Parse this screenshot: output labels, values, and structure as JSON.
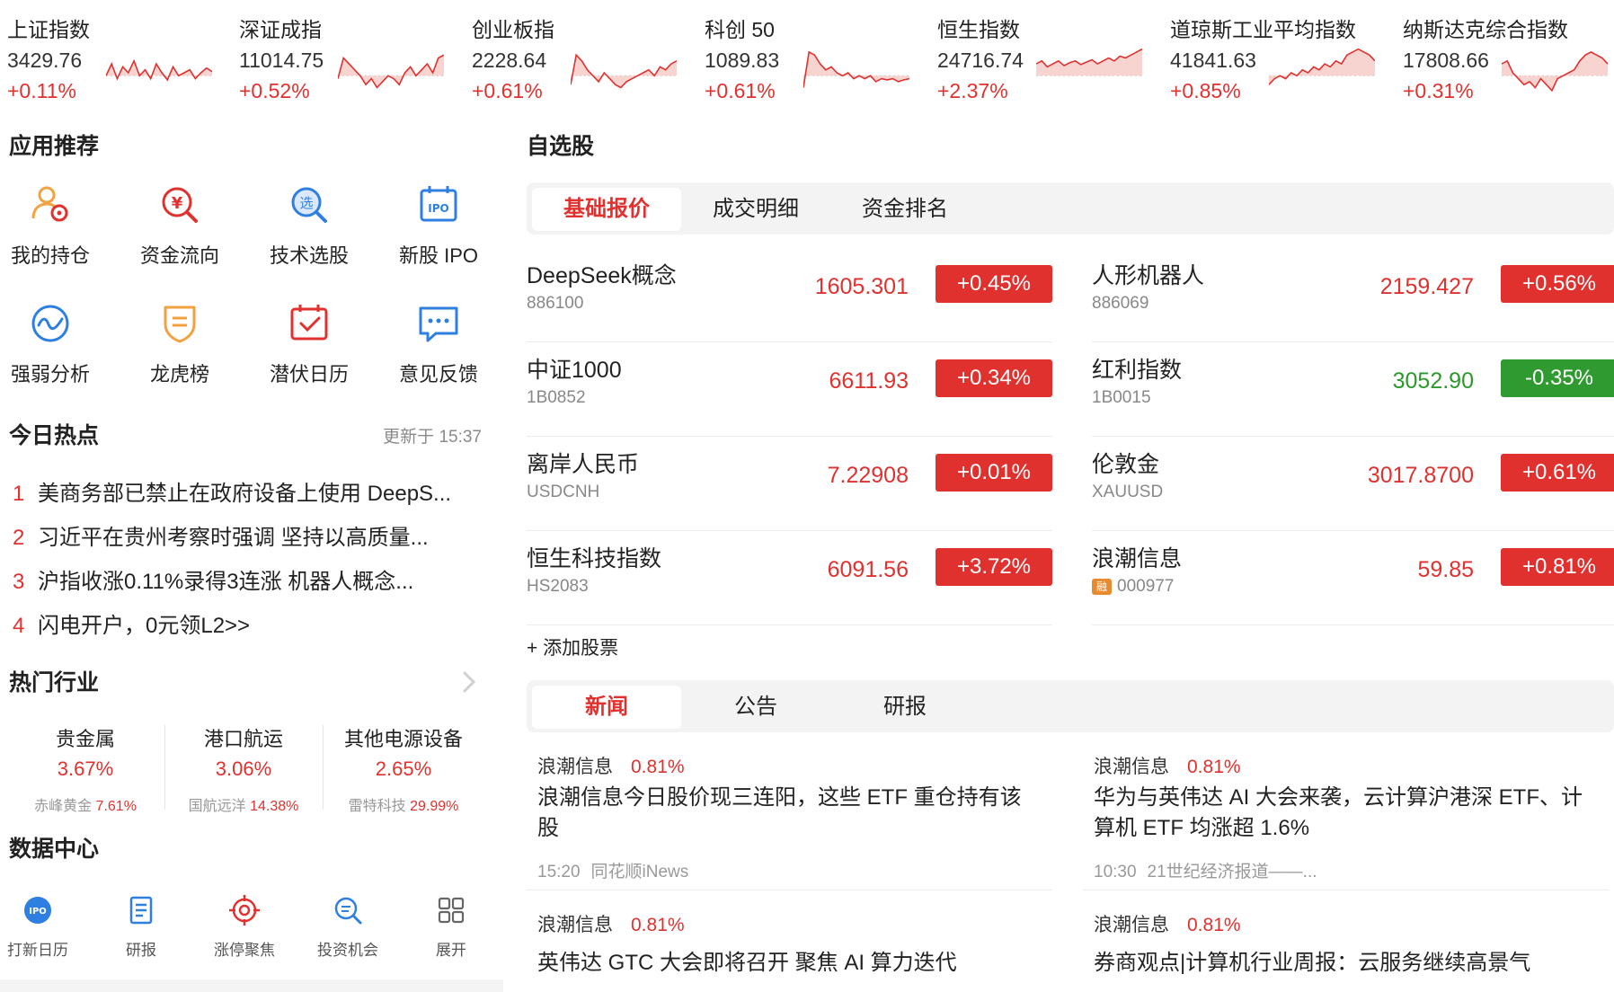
{
  "indices": [
    {
      "name": "上证指数",
      "value": "3429.76",
      "change": "+0.11%",
      "trend": "up",
      "spark": [
        0.55,
        0.35,
        0.6,
        0.4,
        0.5,
        0.3,
        0.55,
        0.45,
        0.6,
        0.35,
        0.5,
        0.62,
        0.4,
        0.55,
        0.5,
        0.45,
        0.6,
        0.5,
        0.42,
        0.48
      ]
    },
    {
      "name": "深证成指",
      "value": "11014.75",
      "change": "+0.52%",
      "trend": "up",
      "spark": [
        0.6,
        0.25,
        0.35,
        0.45,
        0.55,
        0.7,
        0.6,
        0.75,
        0.65,
        0.55,
        0.6,
        0.7,
        0.5,
        0.4,
        0.55,
        0.45,
        0.35,
        0.5,
        0.25,
        0.2
      ]
    },
    {
      "name": "创业板指",
      "value": "2228.64",
      "change": "+0.61%",
      "trend": "up",
      "spark": [
        0.7,
        0.2,
        0.3,
        0.45,
        0.55,
        0.65,
        0.5,
        0.6,
        0.7,
        0.75,
        0.65,
        0.6,
        0.55,
        0.5,
        0.45,
        0.55,
        0.4,
        0.45,
        0.35,
        0.3
      ]
    },
    {
      "name": "科创 50",
      "value": "1089.83",
      "change": "+0.61%",
      "trend": "up",
      "spark": [
        0.75,
        0.15,
        0.2,
        0.35,
        0.45,
        0.4,
        0.5,
        0.55,
        0.5,
        0.6,
        0.55,
        0.6,
        0.55,
        0.65,
        0.6,
        0.62,
        0.6,
        0.65,
        0.62,
        0.6
      ]
    },
    {
      "name": "恒生指数",
      "value": "24716.74",
      "change": "+2.37%",
      "trend": "up",
      "spark": [
        0.35,
        0.3,
        0.4,
        0.35,
        0.3,
        0.38,
        0.33,
        0.3,
        0.36,
        0.32,
        0.28,
        0.35,
        0.3,
        0.25,
        0.3,
        0.22,
        0.25,
        0.2,
        0.15,
        0.1
      ]
    },
    {
      "name": "道琼斯工业平均指数",
      "value": "41841.63",
      "change": "+0.85%",
      "trend": "up",
      "spark": [
        0.7,
        0.6,
        0.55,
        0.6,
        0.5,
        0.55,
        0.45,
        0.5,
        0.4,
        0.45,
        0.35,
        0.4,
        0.3,
        0.35,
        0.2,
        0.15,
        0.1,
        0.15,
        0.2,
        0.3
      ]
    },
    {
      "name": "纳斯达克综合指数",
      "value": "17808.66",
      "change": "+0.31%",
      "trend": "up",
      "spark": [
        0.35,
        0.3,
        0.5,
        0.6,
        0.7,
        0.65,
        0.75,
        0.6,
        0.7,
        0.8,
        0.6,
        0.55,
        0.5,
        0.45,
        0.3,
        0.2,
        0.15,
        0.2,
        0.25,
        0.35
      ]
    }
  ],
  "apps": {
    "title": "应用推荐",
    "items": [
      {
        "label": "我的持仓",
        "icon": "person-holding-icon"
      },
      {
        "label": "资金流向",
        "icon": "money-flow-icon"
      },
      {
        "label": "技术选股",
        "icon": "stock-pick-icon"
      },
      {
        "label": "新股 IPO",
        "icon": "ipo-calendar-icon"
      },
      {
        "label": "强弱分析",
        "icon": "strength-analysis-icon"
      },
      {
        "label": "龙虎榜",
        "icon": "dragon-tiger-icon"
      },
      {
        "label": "潜伏日历",
        "icon": "latent-calendar-icon"
      },
      {
        "label": "意见反馈",
        "icon": "feedback-icon"
      }
    ],
    "icon_colors": {
      "orange": "#f2a240",
      "red": "#e0312f",
      "blue": "#2f7fe0"
    }
  },
  "hot": {
    "title": "今日热点",
    "updated": "更新于 15:37",
    "items": [
      {
        "rank": "1",
        "text": "美商务部已禁止在政府设备上使用 DeepS..."
      },
      {
        "rank": "2",
        "text": "习近平在贵州考察时强调 坚持以高质量..."
      },
      {
        "rank": "3",
        "text": "沪指收涨0.11%录得3连涨 机器人概念..."
      },
      {
        "rank": "4",
        "text": "闪电开户，0元领L2>>"
      }
    ]
  },
  "industries": {
    "title": "热门行业",
    "items": [
      {
        "name": "贵金属",
        "pct": "3.67%",
        "leader": "赤峰黄金",
        "leader_pct": "7.61%"
      },
      {
        "name": "港口航运",
        "pct": "3.06%",
        "leader": "国航远洋",
        "leader_pct": "14.38%"
      },
      {
        "name": "其他电源设备",
        "pct": "2.65%",
        "leader": "雷特科技",
        "leader_pct": "29.99%"
      }
    ]
  },
  "data_center": {
    "title": "数据中心",
    "items": [
      {
        "label": "打新日历",
        "icon": "ipo-badge-icon"
      },
      {
        "label": "研报",
        "icon": "report-icon"
      },
      {
        "label": "涨停聚焦",
        "icon": "target-icon"
      },
      {
        "label": "投资机会",
        "icon": "opportunity-icon"
      },
      {
        "label": "展开",
        "icon": "grid-expand-icon"
      }
    ]
  },
  "watchlist": {
    "title": "自选股",
    "tabs": [
      "基础报价",
      "成交明细",
      "资金排名"
    ],
    "active_tab": 0,
    "stocks": [
      {
        "name": "DeepSeek概念",
        "code": "886100",
        "price": "1605.301",
        "change": "+0.45%",
        "trend": "up"
      },
      {
        "name": "人形机器人",
        "code": "886069",
        "price": "2159.427",
        "change": "+0.56%",
        "trend": "up"
      },
      {
        "name": "中证1000",
        "code": "1B0852",
        "price": "6611.93",
        "change": "+0.34%",
        "trend": "up"
      },
      {
        "name": "红利指数",
        "code": "1B0015",
        "price": "3052.90",
        "change": "-0.35%",
        "trend": "down"
      },
      {
        "name": "离岸人民币",
        "code": "USDCNH",
        "price": "7.22908",
        "change": "+0.01%",
        "trend": "up"
      },
      {
        "name": "伦敦金",
        "code": "XAUUSD",
        "price": "3017.8700",
        "change": "+0.61%",
        "trend": "up"
      },
      {
        "name": "恒生科技指数",
        "code": "HS2083",
        "price": "6091.56",
        "change": "+3.72%",
        "trend": "up"
      },
      {
        "name": "浪潮信息",
        "code": "000977",
        "price": "59.85",
        "change": "+0.81%",
        "trend": "up",
        "badge": "融"
      }
    ],
    "add_label": "+ 添加股票"
  },
  "news": {
    "tabs": [
      "新闻",
      "公告",
      "研报"
    ],
    "active_tab": 0,
    "items": [
      {
        "stock": "浪潮信息",
        "pct": "0.81%",
        "title": "浪潮信息今日股价现三连阳，这些 ETF 重仓持有该股",
        "time": "15:20",
        "source": "同花顺iNews"
      },
      {
        "stock": "浪潮信息",
        "pct": "0.81%",
        "title": "华为与英伟达 AI 大会来袭，云计算沪港深 ETF、计算机 ETF 均涨超 1.6%",
        "time": "10:30",
        "source": "21世纪经济报道——..."
      },
      {
        "stock": "浪潮信息",
        "pct": "0.81%",
        "title": "英伟达 GTC 大会即将召开 聚焦 AI 算力迭代",
        "time": "",
        "source": ""
      },
      {
        "stock": "浪潮信息",
        "pct": "0.81%",
        "title": "券商观点|计算机行业周报：云服务继续高景气",
        "time": "",
        "source": ""
      }
    ]
  },
  "colors": {
    "up": "#e0312f",
    "down": "#2a9a2a",
    "up_fill": "#f6c9c6",
    "down_fill": "#c8e8c4"
  }
}
